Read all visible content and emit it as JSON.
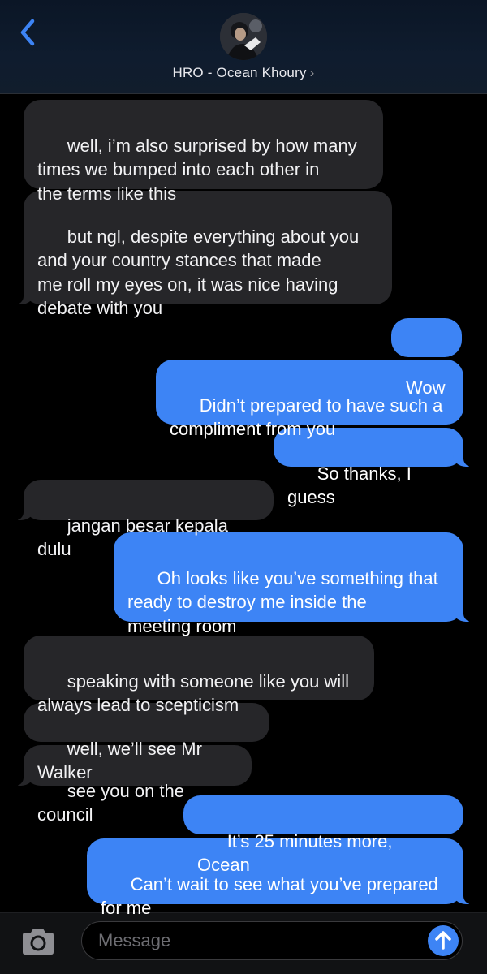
{
  "header": {
    "contact_name": "HRO - Ocean Khoury",
    "chevron": "›",
    "back_icon": "chevron-left-icon",
    "accent_color": "#3d84f5"
  },
  "messages": [
    {
      "direction": "incoming",
      "text": "well, i’m also surprised by how many\ntimes we bumped into each other in\nthe terms like this"
    },
    {
      "direction": "incoming",
      "text": "but ngl, despite everything about you\nand your country stances that made\nme roll my eyes on, it was nice having\ndebate with you"
    },
    {
      "direction": "outgoing",
      "text": "Wow"
    },
    {
      "direction": "outgoing",
      "text": "Didn’t prepared to have such a\ncompliment from you"
    },
    {
      "direction": "outgoing",
      "text": "So thanks, I guess"
    },
    {
      "direction": "incoming",
      "text": "jangan besar kepala dulu"
    },
    {
      "direction": "outgoing",
      "text": "Oh looks like you’ve something that\nready to destroy me inside the\nmeeting room"
    },
    {
      "direction": "incoming",
      "text": "speaking with someone like you will\nalways lead to scepticism"
    },
    {
      "direction": "incoming",
      "text": "well, we’ll see Mr Walker"
    },
    {
      "direction": "incoming",
      "text": "see you on the council"
    },
    {
      "direction": "outgoing",
      "text": "It’s 25 minutes more, Ocean"
    },
    {
      "direction": "outgoing",
      "text": "Can’t wait to see what you’ve prepared\nfor me"
    }
  ],
  "composer": {
    "placeholder": "Message",
    "camera_icon": "camera-icon",
    "send_icon": "arrow-up-icon"
  },
  "colors": {
    "incoming_bubble": "#262629",
    "outgoing_bubble": "#3d84f5",
    "background": "#000000"
  }
}
